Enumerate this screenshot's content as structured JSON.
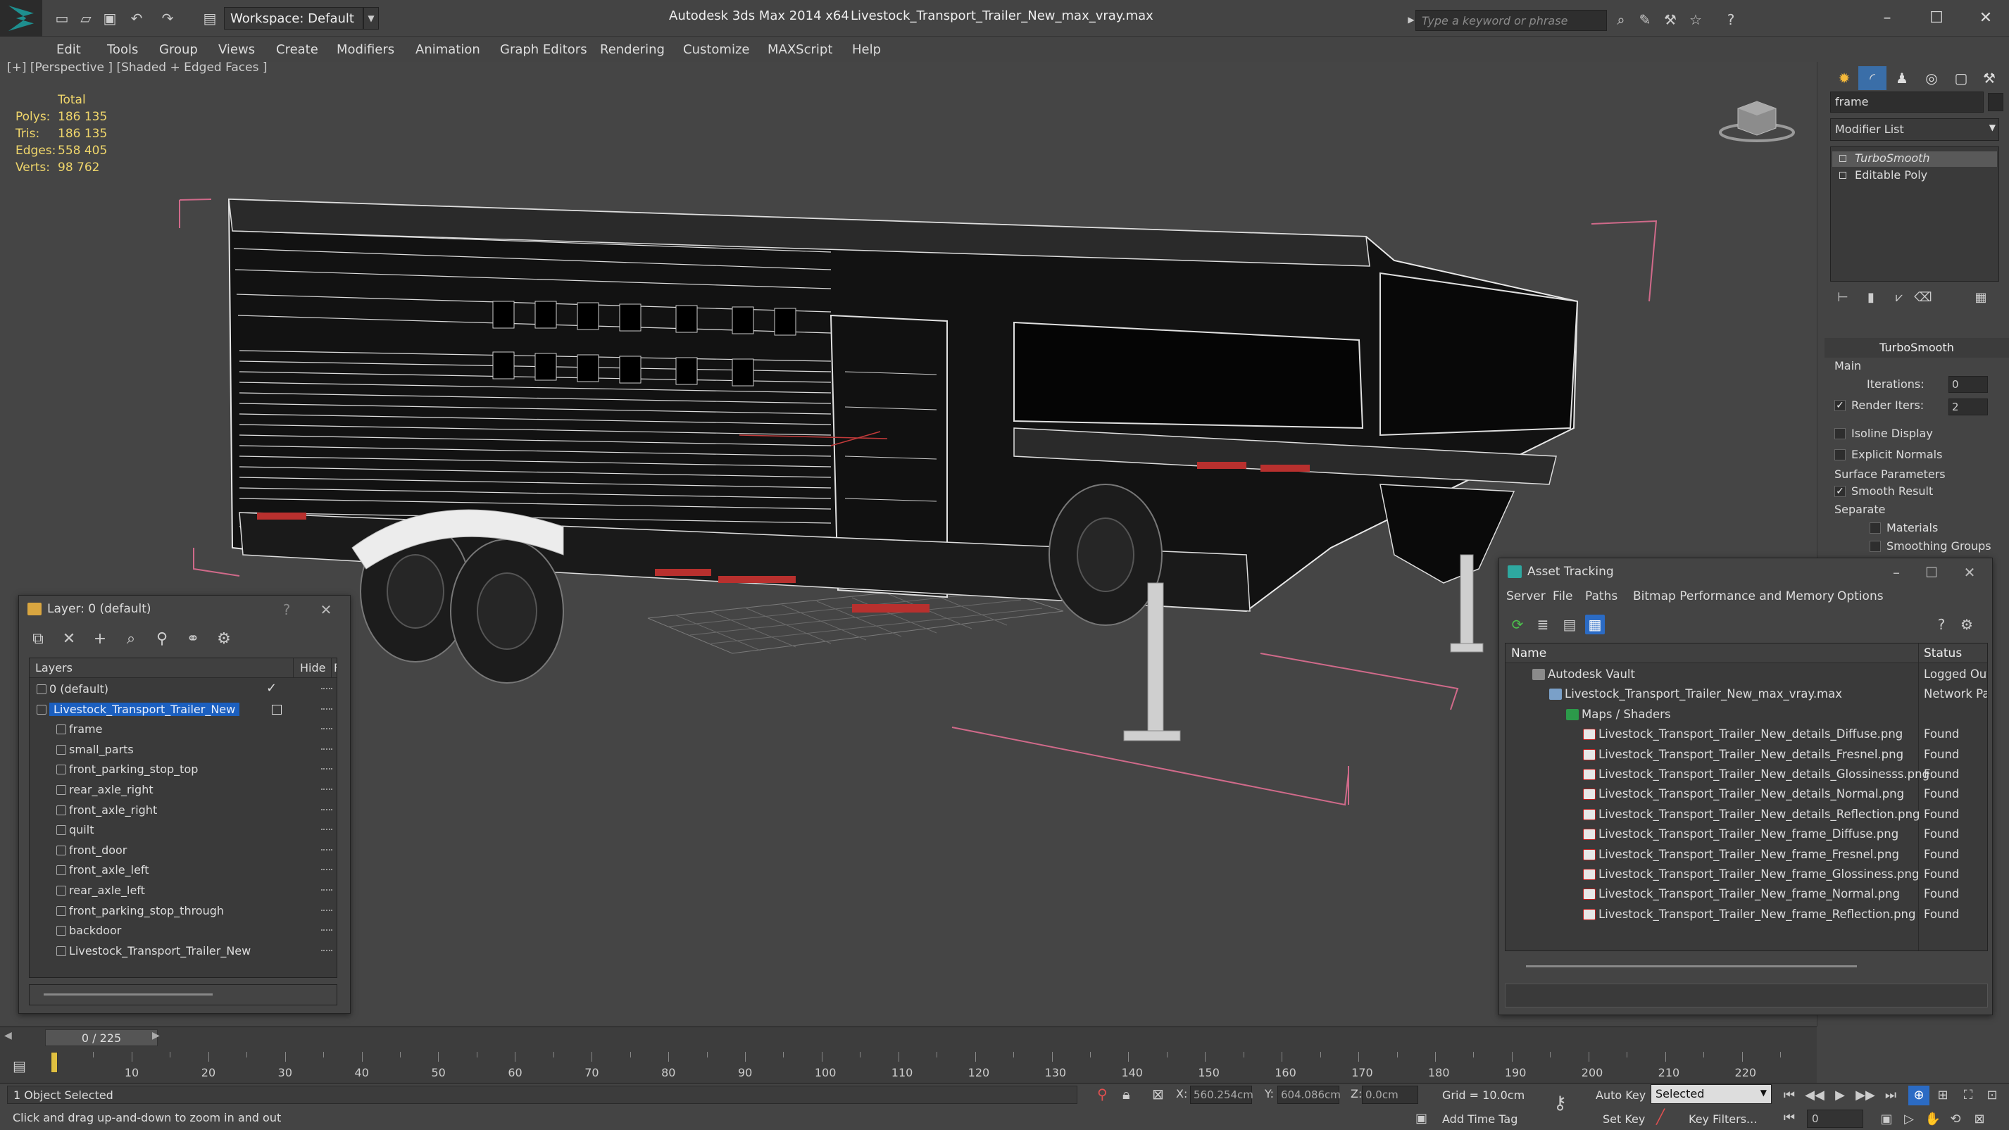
{
  "titlebar": {
    "workspace": "Workspace: Default",
    "app_title": "Autodesk 3ds Max  2014 x64",
    "file_title": "Livestock_Transport_Trailer_New_max_vray.max",
    "search_placeholder": "Type a keyword or phrase"
  },
  "menu": [
    "Edit",
    "Tools",
    "Group",
    "Views",
    "Create",
    "Modifiers",
    "Animation",
    "Graph Editors",
    "Rendering",
    "Customize",
    "MAXScript",
    "Help"
  ],
  "viewport": {
    "label": "[+] [Perspective ] [Shaded + Edged Faces ]",
    "stats_header": "Total",
    "stats": [
      {
        "label": "Polys:",
        "value": "186 135"
      },
      {
        "label": "Tris:",
        "value": "186 135"
      },
      {
        "label": "Edges:",
        "value": "558 405"
      },
      {
        "label": "Verts:",
        "value": "98 762"
      }
    ]
  },
  "cmdpanel": {
    "object_name": "frame",
    "modifier_list": "Modifier List",
    "stack": [
      "TurboSmooth",
      "Editable Poly"
    ],
    "rollout_title": "TurboSmooth",
    "main_label": "Main",
    "iterations_label": "Iterations:",
    "iterations_value": "0",
    "render_iters_label": "Render Iters:",
    "render_iters_value": "2",
    "isoline_label": "Isoline Display",
    "explicit_normals_label": "Explicit Normals",
    "surface_params_label": "Surface Parameters",
    "smooth_result_label": "Smooth Result",
    "separate_label": "Separate",
    "materials_label": "Materials",
    "smoothing_groups_label": "Smoothing Groups"
  },
  "layer_window": {
    "title": "Layer: 0 (default)",
    "help": "?",
    "col_layers": "Layers",
    "col_hide": "Hide",
    "col_f": "F",
    "rows": [
      {
        "name": "0 (default)",
        "indent": 0,
        "check": "✓"
      },
      {
        "name": "Livestock_Transport_Trailer_New",
        "indent": 0,
        "selected": true
      },
      {
        "name": "frame",
        "indent": 1
      },
      {
        "name": "small_parts",
        "indent": 1
      },
      {
        "name": "front_parking_stop_top",
        "indent": 1
      },
      {
        "name": "rear_axle_right",
        "indent": 1
      },
      {
        "name": "front_axle_right",
        "indent": 1
      },
      {
        "name": "quilt",
        "indent": 1
      },
      {
        "name": "front_door",
        "indent": 1
      },
      {
        "name": "front_axle_left",
        "indent": 1
      },
      {
        "name": "rear_axle_left",
        "indent": 1
      },
      {
        "name": "front_parking_stop_through",
        "indent": 1
      },
      {
        "name": "backdoor",
        "indent": 1
      },
      {
        "name": "Livestock_Transport_Trailer_New",
        "indent": 1
      }
    ]
  },
  "asset_window": {
    "title": "Asset Tracking",
    "menu": [
      "Server",
      "File",
      "Paths",
      "Bitmap Performance and Memory",
      "Options"
    ],
    "col_name": "Name",
    "col_status": "Status",
    "rows": [
      {
        "name": "Autodesk Vault",
        "status": "Logged Out",
        "level": 1,
        "icon": "vault"
      },
      {
        "name": "Livestock_Transport_Trailer_New_max_vray.max",
        "status": "Network Pat",
        "level": 2,
        "icon": "max"
      },
      {
        "name": "Maps / Shaders",
        "status": "",
        "level": 3,
        "icon": "maps"
      },
      {
        "name": "Livestock_Transport_Trailer_New_details_Diffuse.png",
        "status": "Found",
        "level": 4,
        "icon": "png"
      },
      {
        "name": "Livestock_Transport_Trailer_New_details_Fresnel.png",
        "status": "Found",
        "level": 4,
        "icon": "png"
      },
      {
        "name": "Livestock_Transport_Trailer_New_details_Glossinesss.png",
        "status": "Found",
        "level": 4,
        "icon": "png"
      },
      {
        "name": "Livestock_Transport_Trailer_New_details_Normal.png",
        "status": "Found",
        "level": 4,
        "icon": "png"
      },
      {
        "name": "Livestock_Transport_Trailer_New_details_Reflection.png",
        "status": "Found",
        "level": 4,
        "icon": "png"
      },
      {
        "name": "Livestock_Transport_Trailer_New_frame_Diffuse.png",
        "status": "Found",
        "level": 4,
        "icon": "png"
      },
      {
        "name": "Livestock_Transport_Trailer_New_frame_Fresnel.png",
        "status": "Found",
        "level": 4,
        "icon": "png"
      },
      {
        "name": "Livestock_Transport_Trailer_New_frame_Glossiness.png",
        "status": "Found",
        "level": 4,
        "icon": "png"
      },
      {
        "name": "Livestock_Transport_Trailer_New_frame_Normal.png",
        "status": "Found",
        "level": 4,
        "icon": "png"
      },
      {
        "name": "Livestock_Transport_Trailer_New_frame_Reflection.png",
        "status": "Found",
        "level": 4,
        "icon": "png"
      }
    ]
  },
  "timeline": {
    "frame_display": "0 / 225",
    "ticks": [
      "10",
      "20",
      "30",
      "40",
      "50",
      "60",
      "70",
      "80",
      "90",
      "100",
      "110",
      "120",
      "130",
      "140",
      "150",
      "160",
      "170",
      "180",
      "190",
      "200",
      "210",
      "220"
    ]
  },
  "status": {
    "selection": "1 Object Selected",
    "prompt": "Click and drag up-and-down to zoom in and out",
    "x_label": "X:",
    "x_value": "560.254cm",
    "y_label": "Y:",
    "y_value": "604.086cm",
    "z_label": "Z:",
    "z_value": "0.0cm",
    "grid": "Grid = 10.0cm",
    "add_time_tag": "Add Time Tag",
    "auto_key": "Auto Key",
    "set_key": "Set Key",
    "selected_mode": "Selected",
    "key_filters": "Key Filters...",
    "current_frame": "0"
  },
  "colors": {
    "selection_blue": "#1b5fbf",
    "stats_yellow": "#f0d66b",
    "bbox_pink": "#d06a8a",
    "viewport_bg": "#454545"
  }
}
